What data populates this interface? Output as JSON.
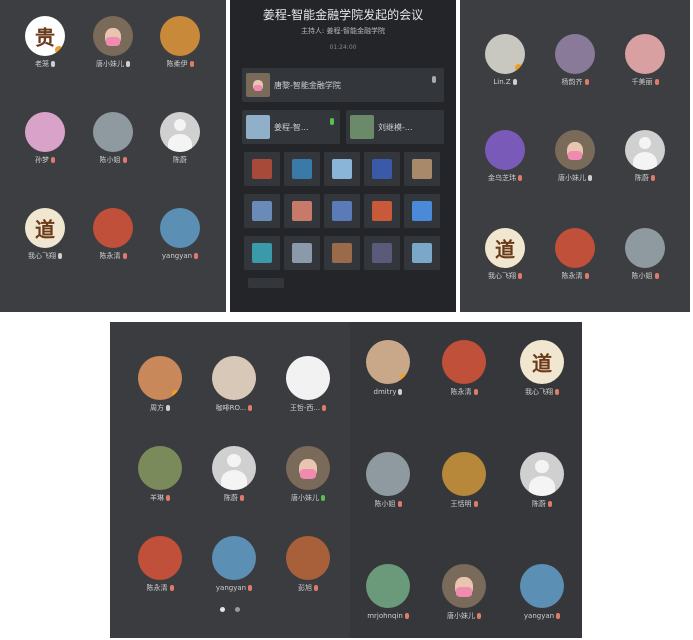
{
  "panel1": {
    "participants": [
      {
        "name": "老笼",
        "mic": "normal",
        "avatar": "calligraphy",
        "color": "#ffffff",
        "symbol": "贵",
        "badge": true
      },
      {
        "name": "唐小妹儿",
        "mic": "normal",
        "avatar": "masked-face",
        "color": "#7a6a5a"
      },
      {
        "name": "陈柔伊",
        "mic": "muted",
        "avatar": "photo",
        "color": "#c88a3a"
      },
      {
        "name": "孙梦",
        "mic": "muted",
        "avatar": "cartoon",
        "color": "#d9a3c9"
      },
      {
        "name": "陈小姐",
        "mic": "muted",
        "avatar": "building",
        "color": "#8f9aa0"
      },
      {
        "name": "陈蔚",
        "mic": "none",
        "avatar": "default",
        "color": "#cfcfcf"
      },
      {
        "name": "我心飞翔",
        "mic": "normal",
        "avatar": "dao",
        "color": "#f1e6cf",
        "symbol": "道"
      },
      {
        "name": "陈永清",
        "mic": "muted",
        "avatar": "photo",
        "color": "#c0503a"
      },
      {
        "name": "yangyan",
        "mic": "muted",
        "avatar": "landscape",
        "color": "#5b8fb3"
      }
    ]
  },
  "meeting": {
    "title": "姜程-智能金融学院发起的会议",
    "host": "主持人: 姜程-智能金融学院",
    "time": "01:24:00",
    "featured": {
      "name": "唐黎-智能金融学院"
    },
    "pair": [
      {
        "name": "姜程-智...",
        "color": "#8fb0c8"
      },
      {
        "name": "刘继模-...",
        "color": "#6a8a6a"
      }
    ],
    "thumbnails": [
      "#a84a3a",
      "#3a7aa8",
      "#8ab4d8",
      "#3a5aa8",
      "#a88a6a",
      "#6a8ab8",
      "#c87a6a",
      "#5a7ab8",
      "#c85a3a",
      "#4a8ad8",
      "#3a9aaa",
      "#8a9aaa",
      "#9a6a4a",
      "#5a5a7a",
      "#7aa8c8"
    ]
  },
  "panel3": {
    "participants": [
      {
        "name": "Lin.Z",
        "mic": "normal",
        "avatar": "bird",
        "color": "#c8c8c0",
        "badge": true
      },
      {
        "name": "杨韵齐",
        "mic": "muted",
        "avatar": "photo",
        "color": "#8a7a9a"
      },
      {
        "name": "千美丽",
        "mic": "muted",
        "avatar": "photo",
        "color": "#d8a0a0"
      },
      {
        "name": "金乌芝玮",
        "mic": "muted",
        "avatar": "tree",
        "color": "#7a5ab8"
      },
      {
        "name": "唐小妹儿",
        "mic": "normal",
        "avatar": "masked-face",
        "color": "#7a6a5a"
      },
      {
        "name": "陈蔚",
        "mic": "muted",
        "avatar": "default",
        "color": "#cfcfcf"
      },
      {
        "name": "我心飞翔",
        "mic": "muted",
        "avatar": "dao",
        "color": "#f1e6cf",
        "symbol": "道"
      },
      {
        "name": "陈永清",
        "mic": "muted",
        "avatar": "photo",
        "color": "#c0503a"
      },
      {
        "name": "陈小姐",
        "mic": "muted",
        "avatar": "building",
        "color": "#8f9aa0"
      }
    ]
  },
  "panel4": {
    "participants": [
      {
        "name": "周方",
        "mic": "normal",
        "avatar": "town",
        "color": "#c8885a",
        "badge": true
      },
      {
        "name": "咖啡RO...",
        "mic": "muted",
        "avatar": "photo",
        "color": "#d8c8b8"
      },
      {
        "name": "王哲-西...",
        "mic": "muted",
        "avatar": "sketch",
        "color": "#f2f2f2"
      },
      {
        "name": "羊琳",
        "mic": "muted",
        "avatar": "mountain",
        "color": "#7a8a5a"
      },
      {
        "name": "陈蔚",
        "mic": "muted",
        "avatar": "default",
        "color": "#cfcfcf"
      },
      {
        "name": "唐小妹儿",
        "mic": "on",
        "avatar": "masked-face",
        "color": "#7a6a5a"
      },
      {
        "name": "陈永清",
        "mic": "muted",
        "avatar": "photo",
        "color": "#c0503a"
      },
      {
        "name": "yangyan",
        "mic": "muted",
        "avatar": "landscape",
        "color": "#5b8fb3"
      },
      {
        "name": "彭旭",
        "mic": "muted",
        "avatar": "photo",
        "color": "#a8603a"
      }
    ]
  },
  "panel5": {
    "participants": [
      {
        "name": "dmitry",
        "mic": "normal",
        "avatar": "cat",
        "color": "#c8a888",
        "badge": true
      },
      {
        "name": "陈永清",
        "mic": "muted",
        "avatar": "photo",
        "color": "#c0503a"
      },
      {
        "name": "我心飞翔",
        "mic": "muted",
        "avatar": "dao",
        "color": "#f1e6cf",
        "symbol": "道"
      },
      {
        "name": "陈小姐",
        "mic": "muted",
        "avatar": "building",
        "color": "#8f9aa0"
      },
      {
        "name": "王恬明",
        "mic": "muted",
        "avatar": "leopard",
        "color": "#b8883a"
      },
      {
        "name": "陈蔚",
        "mic": "muted",
        "avatar": "default",
        "color": "#cfcfcf"
      },
      {
        "name": "mrjohnqin",
        "mic": "muted",
        "avatar": "landscape",
        "color": "#6a9a7a"
      },
      {
        "name": "唐小妹儿",
        "mic": "muted",
        "avatar": "masked-face",
        "color": "#7a6a5a"
      },
      {
        "name": "yangyan",
        "mic": "muted",
        "avatar": "landscape",
        "color": "#5b8fb3"
      }
    ]
  }
}
